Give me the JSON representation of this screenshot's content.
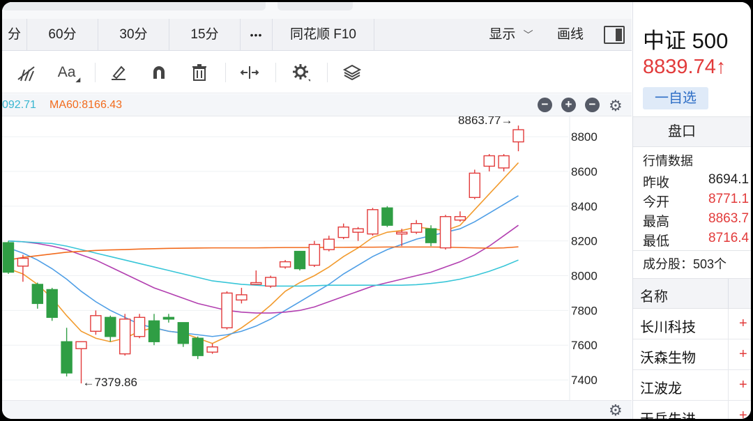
{
  "timeframe_tabs": [
    "分",
    "60分",
    "30分",
    "15分",
    "•••",
    "同花顺 F10"
  ],
  "view_controls": {
    "display_label": "显示",
    "draw_label": "画线"
  },
  "toolbar": {
    "font_tool_label": "Aa"
  },
  "ma_legend": {
    "ma_cut": "092.71",
    "ma60": "MA60:8166.43",
    "colors": {
      "ma5": "#f29b2e",
      "ma10": "#4e9ee6",
      "ma20": "#b23fb0",
      "ma30": "#38c6d8",
      "ma60": "#f26b1d"
    }
  },
  "chart_data": {
    "type": "candlestick",
    "ylim": [
      7300,
      8900
    ],
    "y_ticks": [
      7400,
      7600,
      7800,
      8000,
      8200,
      8400,
      8600,
      8800
    ],
    "annotations": {
      "high": "8863.77",
      "low": "7379.86"
    },
    "candles": [
      {
        "o": 8190,
        "c": 8020,
        "h": 8200,
        "l": 8010,
        "up": false
      },
      {
        "o": 8055,
        "c": 8100,
        "h": 8120,
        "l": 7965,
        "up": true
      },
      {
        "o": 7950,
        "c": 7840,
        "h": 7960,
        "l": 7810,
        "up": false
      },
      {
        "o": 7920,
        "c": 7760,
        "h": 7930,
        "l": 7740,
        "up": false
      },
      {
        "o": 7620,
        "c": 7440,
        "h": 7700,
        "l": 7420,
        "up": false
      },
      {
        "o": 7580,
        "c": 7620,
        "h": 7620,
        "l": 7380,
        "up": true
      },
      {
        "o": 7680,
        "c": 7770,
        "h": 7800,
        "l": 7660,
        "up": true
      },
      {
        "o": 7760,
        "c": 7650,
        "h": 7770,
        "l": 7620,
        "up": false
      },
      {
        "o": 7550,
        "c": 7750,
        "h": 7780,
        "l": 7540,
        "up": true
      },
      {
        "o": 7650,
        "c": 7760,
        "h": 7780,
        "l": 7640,
        "up": true
      },
      {
        "o": 7740,
        "c": 7620,
        "h": 7780,
        "l": 7600,
        "up": false
      },
      {
        "o": 7760,
        "c": 7750,
        "h": 7780,
        "l": 7730,
        "up": false
      },
      {
        "o": 7730,
        "c": 7610,
        "h": 7730,
        "l": 7590,
        "up": false
      },
      {
        "o": 7640,
        "c": 7540,
        "h": 7650,
        "l": 7520,
        "up": false
      },
      {
        "o": 7560,
        "c": 7590,
        "h": 7610,
        "l": 7550,
        "up": true
      },
      {
        "o": 7700,
        "c": 7900,
        "h": 7910,
        "l": 7690,
        "up": true
      },
      {
        "o": 7860,
        "c": 7890,
        "h": 7930,
        "l": 7840,
        "up": true
      },
      {
        "o": 7950,
        "c": 7960,
        "h": 8030,
        "l": 7950,
        "up": true
      },
      {
        "o": 7940,
        "c": 7990,
        "h": 8000,
        "l": 7930,
        "up": true
      },
      {
        "o": 8050,
        "c": 8080,
        "h": 8090,
        "l": 8040,
        "up": true
      },
      {
        "o": 8140,
        "c": 8040,
        "h": 8140,
        "l": 8030,
        "up": false
      },
      {
        "o": 8060,
        "c": 8180,
        "h": 8200,
        "l": 8050,
        "up": true
      },
      {
        "o": 8150,
        "c": 8210,
        "h": 8230,
        "l": 8140,
        "up": true
      },
      {
        "o": 8220,
        "c": 8280,
        "h": 8300,
        "l": 8210,
        "up": true
      },
      {
        "o": 8250,
        "c": 8270,
        "h": 8280,
        "l": 8200,
        "up": true
      },
      {
        "o": 8240,
        "c": 8380,
        "h": 8390,
        "l": 8230,
        "up": true
      },
      {
        "o": 8390,
        "c": 8290,
        "h": 8400,
        "l": 8280,
        "up": false
      },
      {
        "o": 8250,
        "c": 8240,
        "h": 8270,
        "l": 8170,
        "up": true
      },
      {
        "o": 8250,
        "c": 8300,
        "h": 8320,
        "l": 8240,
        "up": true
      },
      {
        "o": 8270,
        "c": 8190,
        "h": 8290,
        "l": 8170,
        "up": false
      },
      {
        "o": 8160,
        "c": 8340,
        "h": 8350,
        "l": 8150,
        "up": true
      },
      {
        "o": 8320,
        "c": 8340,
        "h": 8370,
        "l": 8310,
        "up": true
      },
      {
        "o": 8450,
        "c": 8590,
        "h": 8610,
        "l": 8440,
        "up": true
      },
      {
        "o": 8630,
        "c": 8690,
        "h": 8700,
        "l": 8600,
        "up": true
      },
      {
        "o": 8620,
        "c": 8690,
        "h": 8700,
        "l": 8600,
        "up": true
      },
      {
        "o": 8770,
        "c": 8840,
        "h": 8864,
        "l": 8716,
        "up": true
      }
    ],
    "ma_series": {
      "ma5": [
        8040,
        8010,
        7950,
        7870,
        7770,
        7680,
        7640,
        7620,
        7640,
        7680,
        7700,
        7680,
        7670,
        7640,
        7610,
        7650,
        7700,
        7760,
        7830,
        7910,
        7960,
        8000,
        8050,
        8110,
        8160,
        8220,
        8250,
        8260,
        8280,
        8270,
        8260,
        8290,
        8380,
        8470,
        8560,
        8650
      ],
      "ma10": [
        8160,
        8130,
        8090,
        8040,
        7980,
        7910,
        7850,
        7800,
        7760,
        7720,
        7700,
        7680,
        7670,
        7660,
        7650,
        7660,
        7680,
        7710,
        7750,
        7800,
        7850,
        7900,
        7950,
        8010,
        8060,
        8110,
        8150,
        8180,
        8210,
        8230,
        8250,
        8270,
        8310,
        8360,
        8410,
        8460
      ],
      "ma20": [
        8200,
        8195,
        8185,
        8170,
        8150,
        8120,
        8090,
        8050,
        8010,
        7970,
        7930,
        7900,
        7870,
        7840,
        7820,
        7800,
        7790,
        7785,
        7785,
        7790,
        7800,
        7820,
        7850,
        7880,
        7910,
        7940,
        7960,
        7980,
        8000,
        8020,
        8050,
        8080,
        8120,
        8170,
        8230,
        8290
      ],
      "ma30": [
        8200,
        8195,
        8190,
        8185,
        8170,
        8150,
        8130,
        8110,
        8090,
        8070,
        8050,
        8030,
        8010,
        7990,
        7970,
        7960,
        7950,
        7945,
        7940,
        7940,
        7940,
        7942,
        7945,
        7945,
        7945,
        7945,
        7945,
        7945,
        7948,
        7955,
        7965,
        7980,
        8000,
        8025,
        8055,
        8090
      ],
      "ma60": [
        8090,
        8105,
        8115,
        8125,
        8135,
        8140,
        8145,
        8148,
        8150,
        8153,
        8155,
        8157,
        8158,
        8159,
        8160,
        8160,
        8160,
        8160,
        8161,
        8162,
        8162,
        8162,
        8163,
        8163,
        8164,
        8164,
        8165,
        8165,
        8165,
        8165,
        8164,
        8162,
        8160,
        8158,
        8160,
        8166
      ]
    }
  },
  "right_panel": {
    "index_name": "中证 500",
    "price": "8839.74↑",
    "watch_button": "一自选",
    "pankou_title": "盘口",
    "quotes_title": "行情数据",
    "quotes": [
      {
        "label": "昨收",
        "value": "8694.1",
        "color": "#222222"
      },
      {
        "label": "今开",
        "value": "8771.1",
        "color": "#e23b3b"
      },
      {
        "label": "最高",
        "value": "8863.7",
        "color": "#e23b3b"
      },
      {
        "label": "最低",
        "value": "8716.4",
        "color": "#e23b3b"
      }
    ],
    "components_label": "成分股：503个",
    "name_header": "名称",
    "stocks": [
      {
        "name": "长川科技",
        "mark": "+"
      },
      {
        "name": "沃森生物",
        "mark": "+"
      },
      {
        "name": "江波龙",
        "mark": "+"
      },
      {
        "name": "天岳先进",
        "mark": "+"
      }
    ]
  }
}
